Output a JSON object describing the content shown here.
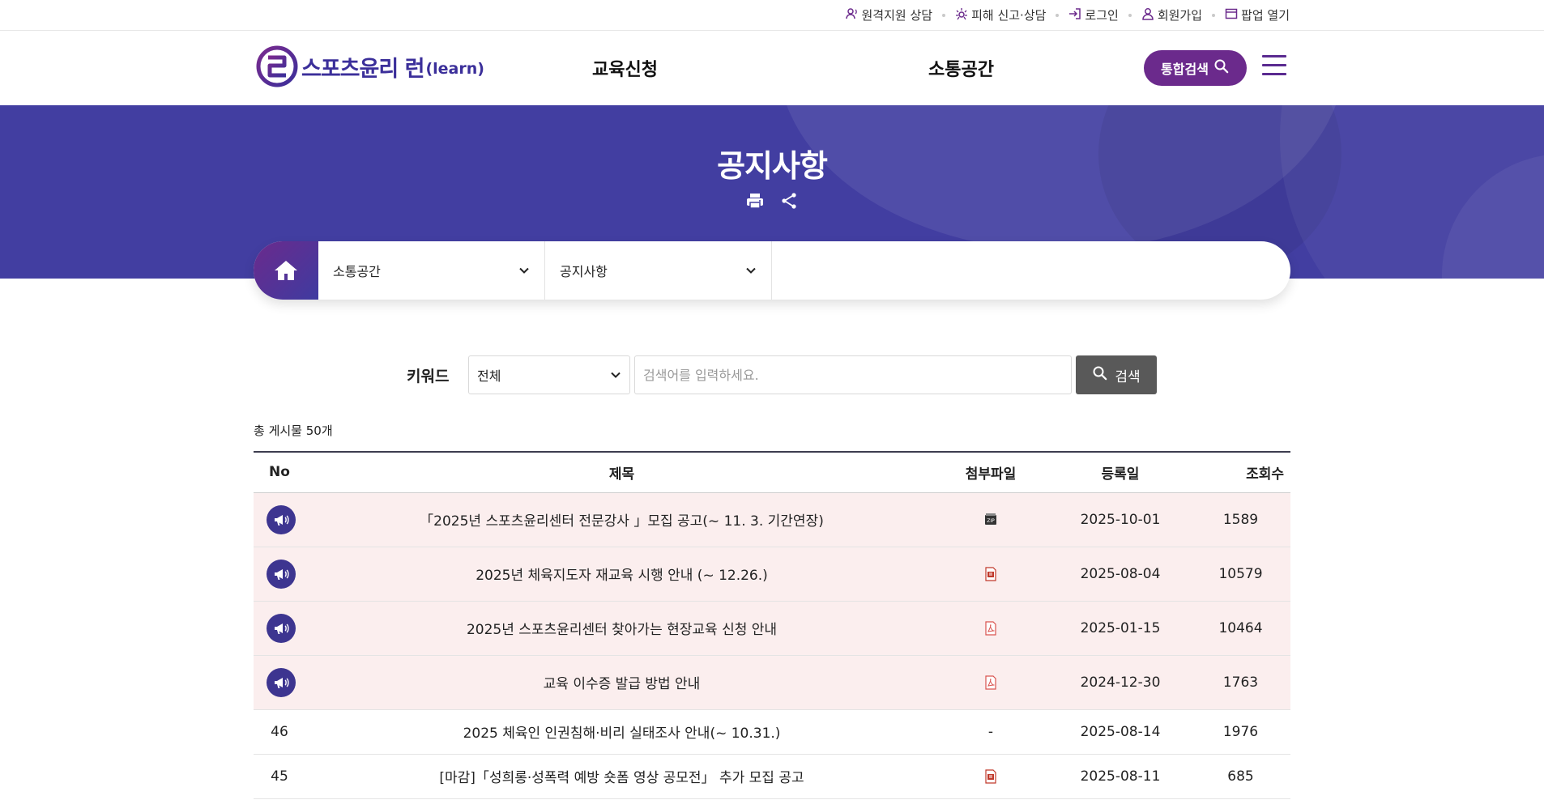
{
  "util_links": [
    {
      "label": "원격지원 상담",
      "icon": "remote-support-icon"
    },
    {
      "label": "피해 신고·상담",
      "icon": "report-icon"
    },
    {
      "label": "로그인",
      "icon": "login-icon"
    },
    {
      "label": "회원가입",
      "icon": "user-icon"
    },
    {
      "label": "팝업 열기",
      "icon": "popup-icon"
    }
  ],
  "logo": {
    "text": "스포츠윤리 런",
    "sub": "(learn)"
  },
  "gnb": [
    "교육신청",
    "소통공간"
  ],
  "header_search": {
    "label": "통합검색"
  },
  "banner": {
    "title": "공지사항"
  },
  "location": {
    "level1": "소통공간",
    "level2": "공지사항"
  },
  "search": {
    "label": "키워드",
    "select_value": "전체",
    "placeholder": "검색어를 입력하세요.",
    "button": "검색"
  },
  "total": "총 게시물 50개",
  "table": {
    "headers": [
      "No",
      "제목",
      "첨부파일",
      "등록일",
      "조회수"
    ],
    "rows": [
      {
        "no": "",
        "notice": true,
        "title": "「2025년 스포츠윤리센터 전문강사 」모집 공고(~ 11. 3. 기간연장)",
        "file": "zip",
        "date": "2025-10-01",
        "views": "1589"
      },
      {
        "no": "",
        "notice": true,
        "title": "2025년 체육지도자 재교육 시행 안내 (~ 12.26.)",
        "file": "hwp",
        "date": "2025-08-04",
        "views": "10579"
      },
      {
        "no": "",
        "notice": true,
        "title": "2025년 스포츠윤리센터 찾아가는 현장교육 신청 안내",
        "file": "pdf",
        "date": "2025-01-15",
        "views": "10464"
      },
      {
        "no": "",
        "notice": true,
        "title": "교육 이수증 발급 방법 안내",
        "file": "pdf",
        "date": "2024-12-30",
        "views": "1763"
      },
      {
        "no": "46",
        "notice": false,
        "title": "2025 체육인 인권침해·비리 실태조사 안내(~ 10.31.)",
        "file": "-",
        "date": "2025-08-14",
        "views": "1976"
      },
      {
        "no": "45",
        "notice": false,
        "title": "[마감]「성희롱·성폭력 예방 숏폼 영상 공모전」 추가 모집 공고",
        "file": "hwp",
        "date": "2025-08-11",
        "views": "685"
      }
    ]
  },
  "colors": {
    "brand_purple": "#6b2a8c",
    "banner": "#423ea1",
    "notice_row": "#fbeeee",
    "search_button": "#595959"
  }
}
